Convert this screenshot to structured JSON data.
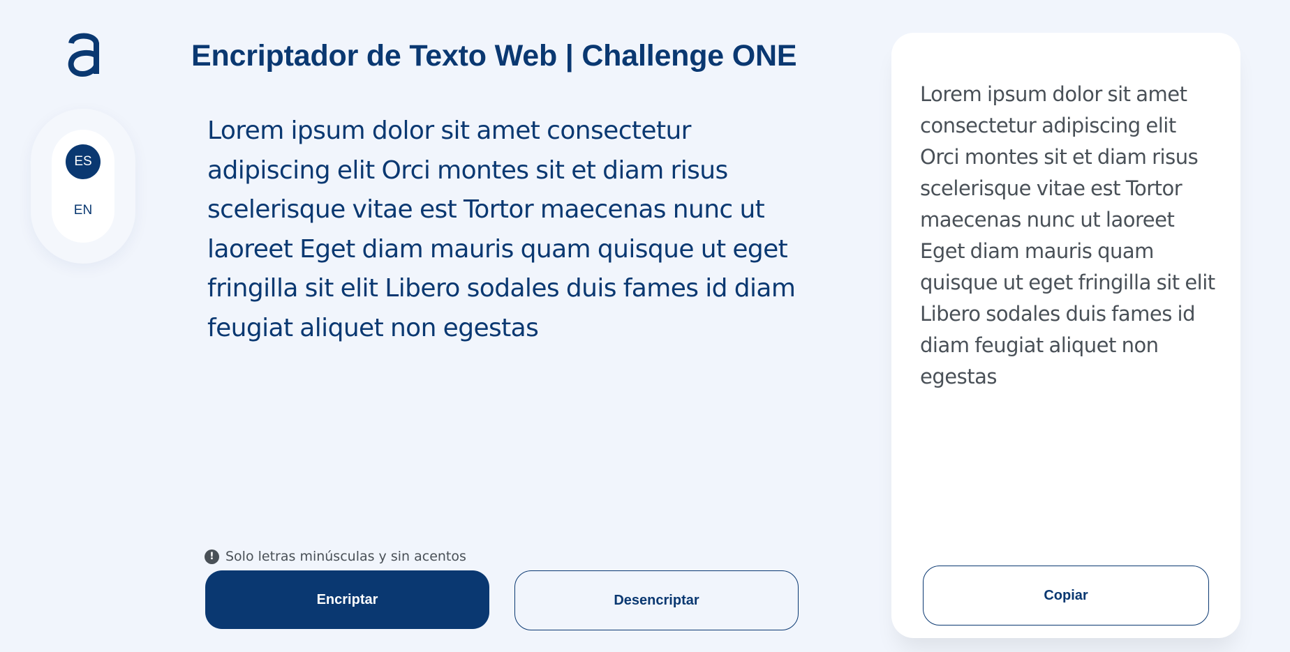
{
  "logo": {
    "icon": "alura-logo-icon",
    "color": "#0A3871"
  },
  "language": {
    "options": [
      {
        "label": "ES",
        "active": true
      },
      {
        "label": "EN",
        "active": false
      }
    ]
  },
  "header": {
    "title": "Encriptador de Texto Web | Challenge ONE"
  },
  "input": {
    "value": "Lorem ipsum dolor sit amet consectetur adipiscing elit Orci montes sit et diam risus scelerisque vitae est Tortor maecenas nunc ut laoreet Eget diam mauris quam quisque ut eget fringilla sit elit Libero sodales duis fames id diam feugiat aliquet non egestas"
  },
  "hint": {
    "icon": "exclamation-circle-icon",
    "text": "Solo letras minúsculas y sin acentos"
  },
  "actions": {
    "encrypt_label": "Encriptar",
    "decrypt_label": "Desencriptar"
  },
  "output": {
    "value": "Lorem ipsum dolor sit amet consectetur adipiscing elit Orci montes sit et diam risus scelerisque vitae est Tortor maecenas nunc ut laoreet Eget diam mauris quam quisque ut eget fringilla sit elit Libero sodales duis fames id diam feugiat aliquet non egestas",
    "copy_label": "Copiar"
  },
  "colors": {
    "primary": "#0A3871",
    "background": "#F1F5FC",
    "panel": "#FFFFFF",
    "muted_text": "#495057"
  }
}
